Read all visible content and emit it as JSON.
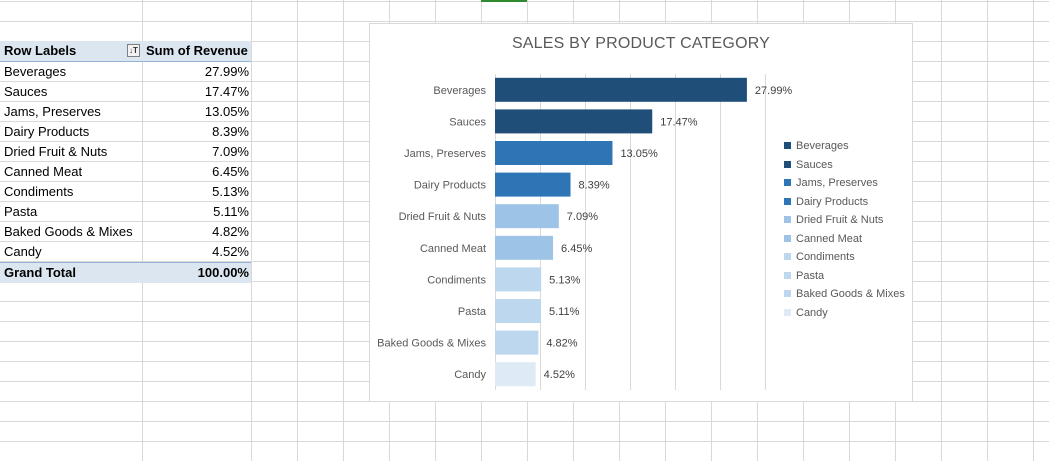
{
  "pivot": {
    "header": {
      "row_labels": "Row Labels",
      "sum_label": "Sum of Revenue"
    },
    "rows": [
      {
        "label": "Beverages",
        "value": "27.99%"
      },
      {
        "label": "Sauces",
        "value": "17.47%"
      },
      {
        "label": "Jams, Preserves",
        "value": "13.05%"
      },
      {
        "label": "Dairy Products",
        "value": "8.39%"
      },
      {
        "label": "Dried Fruit & Nuts",
        "value": "7.09%"
      },
      {
        "label": "Canned Meat",
        "value": "6.45%"
      },
      {
        "label": "Condiments",
        "value": "5.13%"
      },
      {
        "label": "Pasta",
        "value": "5.11%"
      },
      {
        "label": "Baked Goods & Mixes",
        "value": "4.82%"
      },
      {
        "label": "Candy",
        "value": "4.52%"
      }
    ],
    "total": {
      "label": "Grand Total",
      "value": "100.00%"
    }
  },
  "chart_data": {
    "type": "bar",
    "orientation": "horizontal",
    "title": "SALES BY PRODUCT CATEGORY",
    "categories": [
      "Beverages",
      "Sauces",
      "Jams, Preserves",
      "Dairy Products",
      "Dried Fruit & Nuts",
      "Canned Meat",
      "Condiments",
      "Pasta",
      "Baked Goods & Mixes",
      "Candy"
    ],
    "values": [
      27.99,
      17.47,
      13.05,
      8.39,
      7.09,
      6.45,
      5.13,
      5.11,
      4.82,
      4.52
    ],
    "value_labels": [
      "27.99%",
      "17.47%",
      "13.05%",
      "8.39%",
      "7.09%",
      "6.45%",
      "5.13%",
      "5.11%",
      "4.82%",
      "4.52%"
    ],
    "colors": [
      "#1f4e79",
      "#1f4e79",
      "#2e75b6",
      "#2e75b6",
      "#9dc3e6",
      "#9dc3e6",
      "#bdd7ee",
      "#bdd7ee",
      "#bdd7ee",
      "#deebf7"
    ],
    "xlim": [
      0,
      30
    ],
    "grid": true,
    "legend": "right"
  }
}
